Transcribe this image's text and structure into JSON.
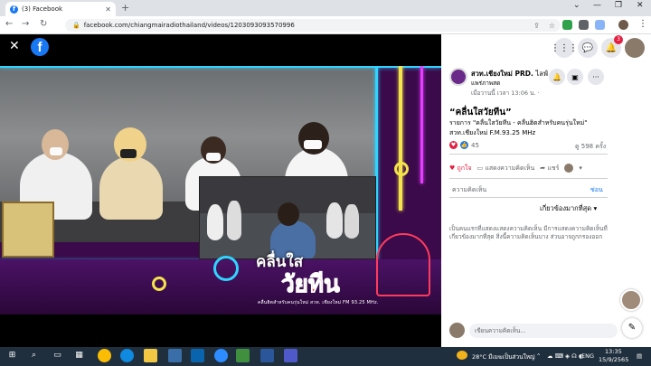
{
  "browser": {
    "tab_title": "(3) Facebook",
    "tab_favicon": "f",
    "tab_close": "✕",
    "new_tab": "+",
    "url": "facebook.com/chiangmairadiothailand/videos/1203093093570996",
    "window_controls": [
      "⌄",
      "—",
      "❐",
      "✕"
    ]
  },
  "viewer": {
    "close_icon": "✕",
    "logo_letter": "f"
  },
  "video_overlay": {
    "title_line1": "คลื่นใส",
    "title_line2": "วัยทีน",
    "tagline": "คลื่นฮิตสำหรับคนรุ่นใหม่ สวท. เชียงใหม่ FM 93.25 MHz."
  },
  "panel": {
    "top_icons": [
      "⋮⋮⋮",
      "💬",
      "🔔"
    ],
    "notification_count": "3",
    "page_name": "สวท.เชียงใหม่ PRD.",
    "page_name_suffix": "ไลฟ์",
    "page_sub": "แพร่ภาพสด",
    "page_date": "เมื่อวานนี้ เวลา 13:06 น. ·",
    "post_title": "“คลื่นใสวัยทีน”",
    "post_lines": [
      "รายการ \"คลื่นใสวัยทีน - คลื่นฮิตสำหรับคนรุ่นใหม่\"",
      "สวท.เชียงใหม่ F.M.93.25 MHz"
    ],
    "reaction_count": "45",
    "view_count": "ดู 598 ครั้ง",
    "actions": {
      "like": "ถูกใจ",
      "comment": "แสดงความคิดเห็น",
      "share": "แชร์"
    },
    "comments_label": "ความคิดเห็น",
    "hide_link": "ซ่อน",
    "sort_label": "เกี่ยวข้องมากที่สุด",
    "empty_text": "เป็นคนแรกที่แสดงแสดงความคิดเห็น มีการแสดงความคิดเห็นที่เกี่ยวข้องมากที่สุด สิ่งนี้ความคิดเห็นบาง ส่วนอาจถูกกรองออก",
    "comment_placeholder": "เขียนความคิดเห็น...",
    "compose_icon": "✎"
  },
  "taskbar": {
    "weather": "28°C มีเมฆเป็นส่วนใหญ่",
    "language": "ENG",
    "time": "13:35",
    "date": "15/9/2565",
    "start_icon": "⊞",
    "search_icon": "⌕"
  },
  "colors": {
    "facebook_blue": "#1877f2",
    "neon_cyan": "#2fd4ff",
    "neon_yellow": "#f4e34a",
    "like_red": "#e41e3f"
  }
}
